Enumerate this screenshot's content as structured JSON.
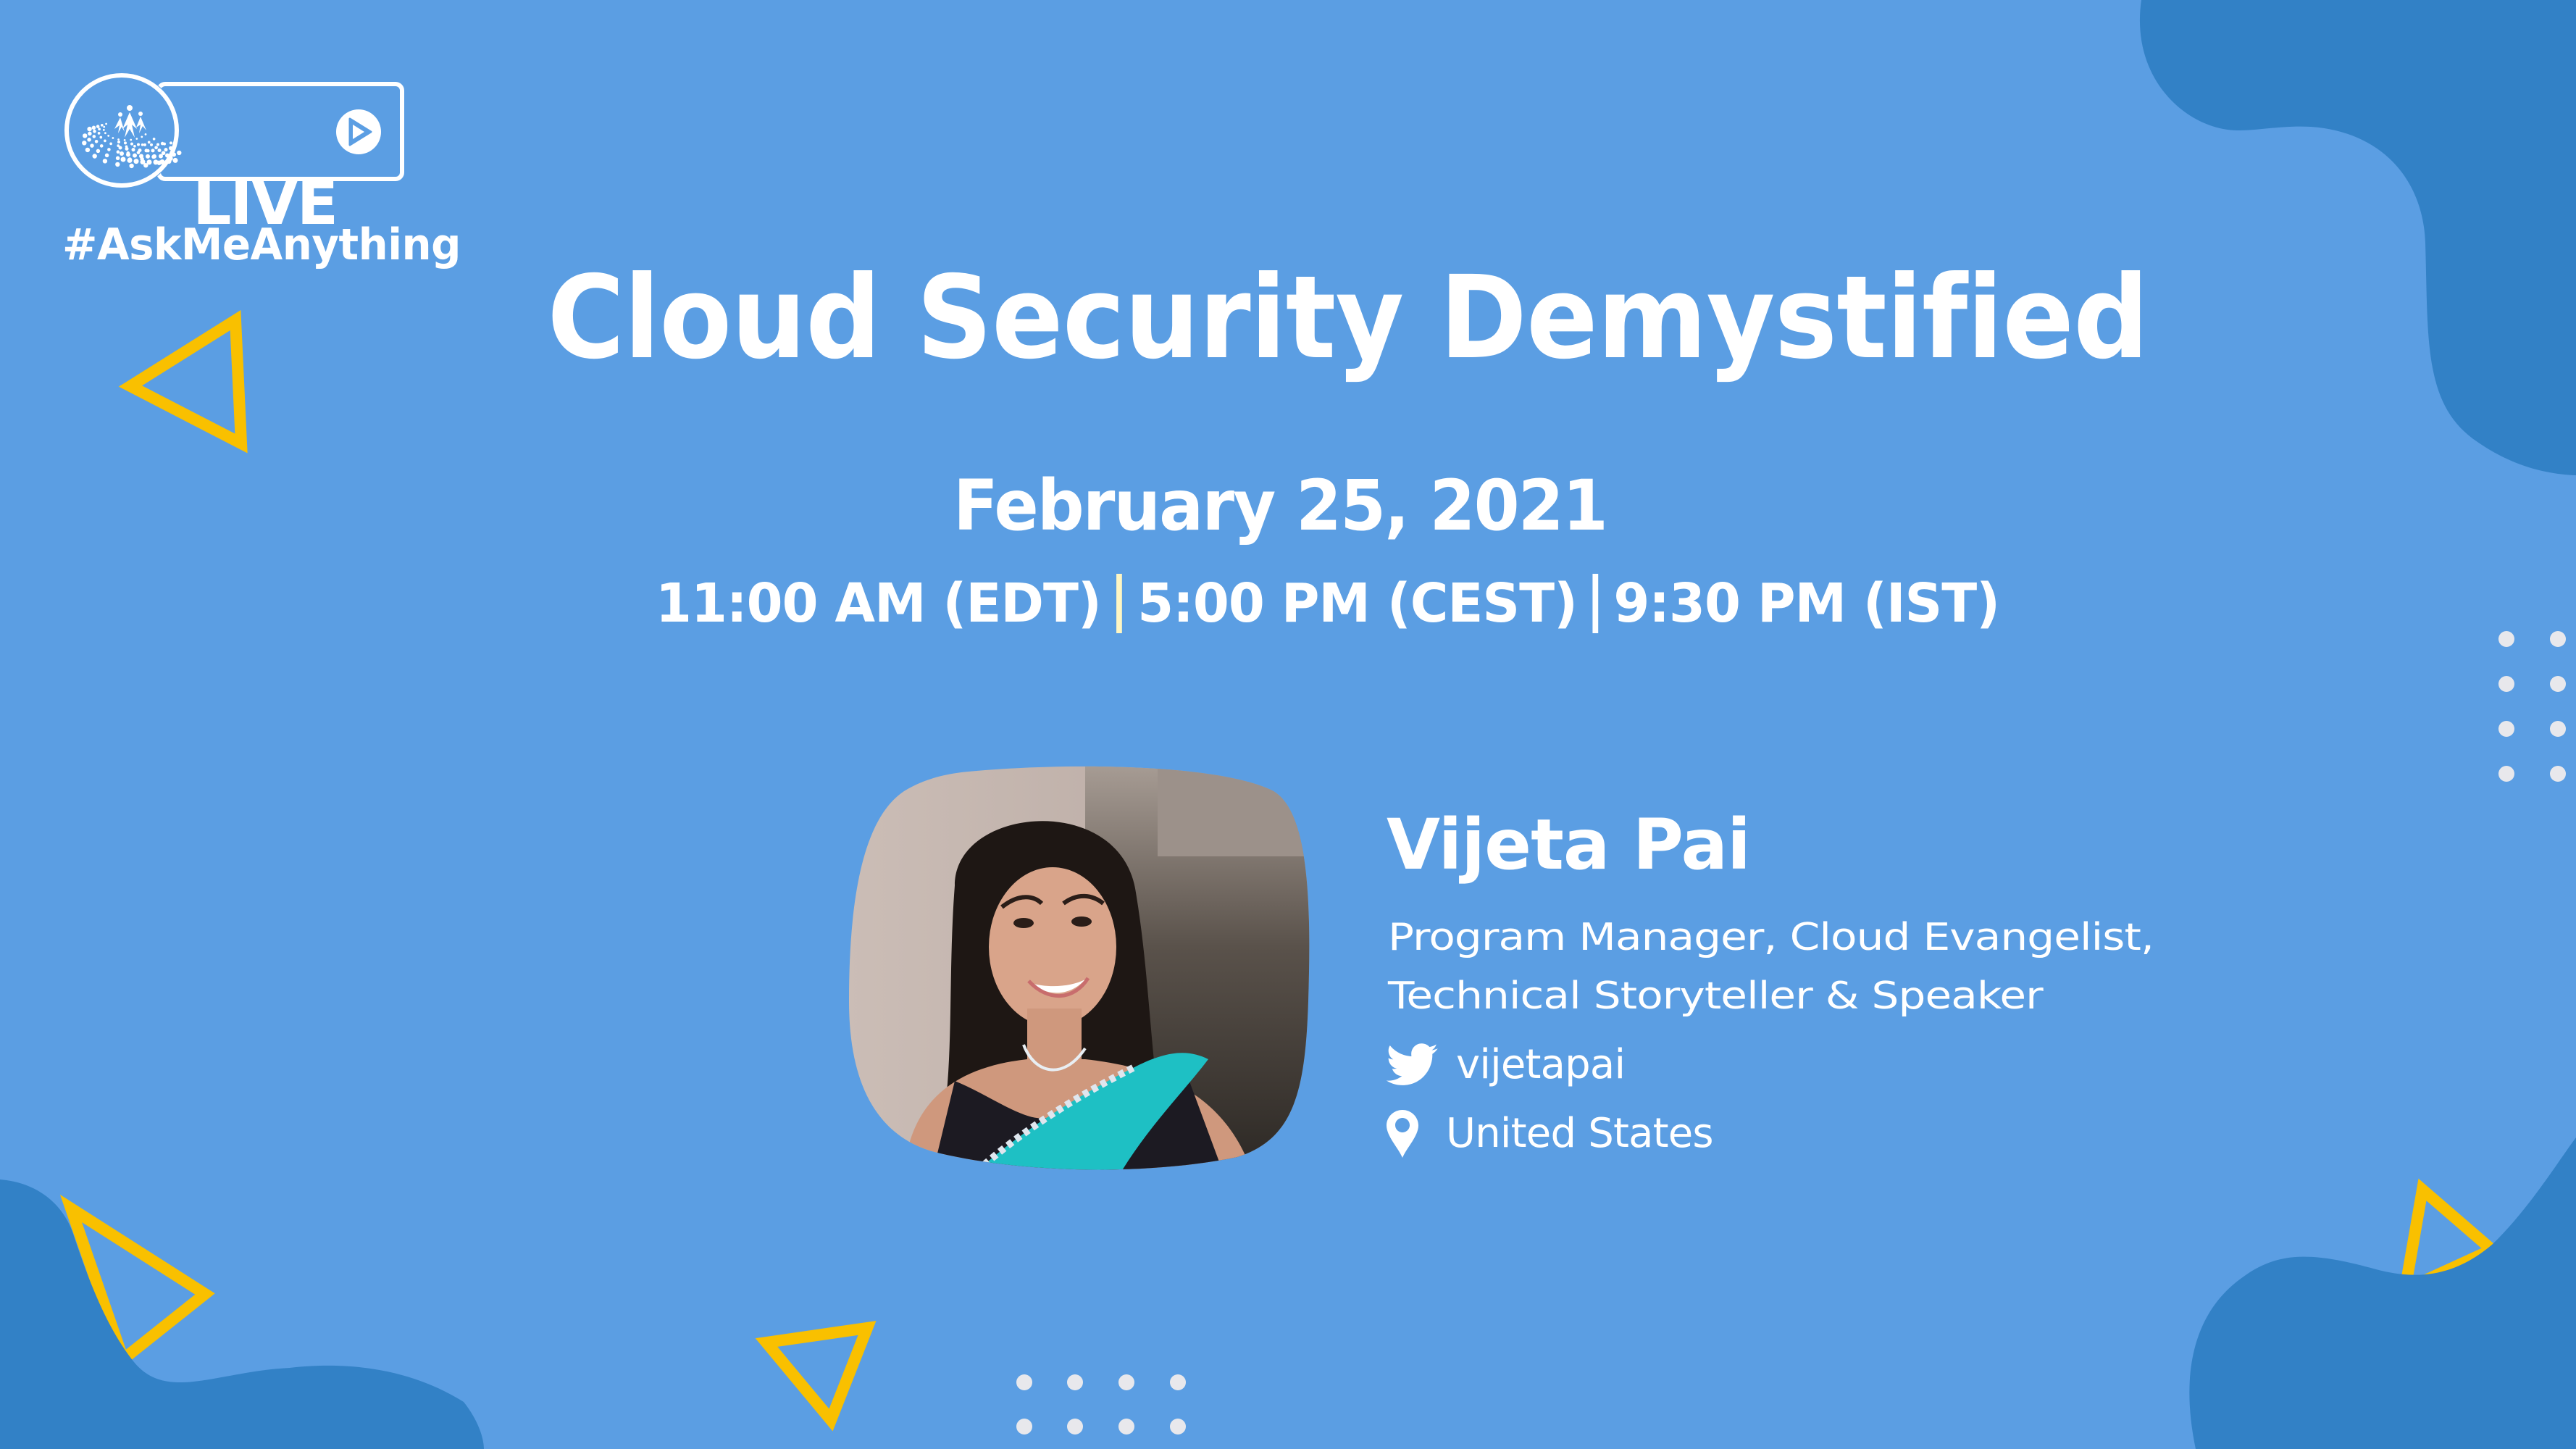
{
  "colors": {
    "background": "#5B9EE3",
    "blob": "#3281C6",
    "accent_yellow": "#F9C000",
    "text": "#FFFFFF",
    "separator_first": "#FFF6C2",
    "separator_second": "#FFFFFF",
    "dots": "#E8E8EC"
  },
  "badge": {
    "label": "LIVE",
    "logo_icon": "community-logo-icon",
    "play_icon": "play-circle-icon"
  },
  "hashtag": "#AskMeAnything",
  "event": {
    "title": "Cloud Security Demystified",
    "date": "February 25, 2021",
    "times": [
      "11:00 AM (EDT)",
      "5:00 PM (CEST)",
      "9:30 PM (IST)"
    ]
  },
  "speaker": {
    "name": "Vijeta Pai",
    "role_line1": "Program Manager, Cloud Evangelist,",
    "role_line2": "Technical Storyteller & Speaker",
    "twitter_handle": "vijetapai",
    "twitter_icon": "twitter-bird-icon",
    "location": "United States",
    "location_icon": "map-pin-icon",
    "photo": "speaker-portrait"
  },
  "decorations": {
    "triangles": [
      "outline-triangle",
      "outline-triangle",
      "outline-triangle",
      "outline-triangle"
    ],
    "dot_grids": [
      "dot-grid-right-2x4",
      "dot-grid-bottom-4x2"
    ]
  }
}
